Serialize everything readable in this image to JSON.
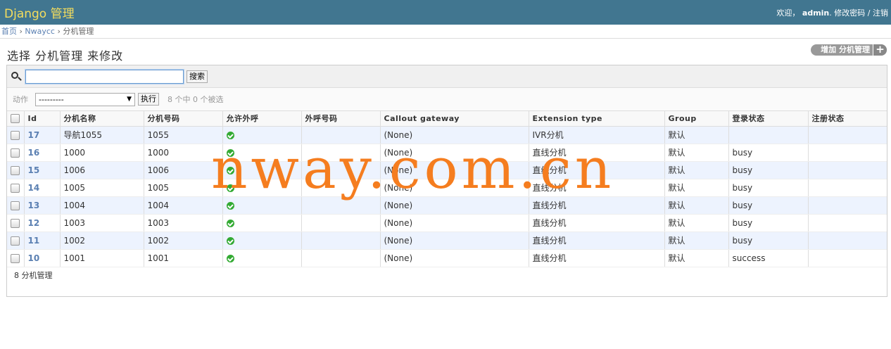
{
  "header": {
    "brand": "Django 管理",
    "welcome": "欢迎，",
    "username": "admin",
    "change_password": "修改密码",
    "separator": "/",
    "logout": "注销"
  },
  "breadcrumbs": {
    "home": "首页",
    "app": "Nwaycc",
    "current": "分机管理",
    "sep": "›"
  },
  "page": {
    "title": "选择 分机管理 来修改",
    "add_button": "增加 分机管理",
    "add_icon": "+"
  },
  "search": {
    "value": "",
    "button": "搜索"
  },
  "actions": {
    "label": "动作",
    "selected": "---------",
    "go": "执行",
    "counter": "8 个中 0 个被选"
  },
  "table": {
    "headers": [
      "Id",
      "分机名称",
      "分机号码",
      "允许外呼",
      "外呼号码",
      "Callout gateway",
      "Extension type",
      "Group",
      "登录状态",
      "注册状态"
    ],
    "rows": [
      {
        "id": "17",
        "name": "导航1055",
        "number": "1055",
        "allow": true,
        "out_number": "",
        "gateway": "(None)",
        "type": "IVR分机",
        "group": "默认",
        "login": "",
        "register": ""
      },
      {
        "id": "16",
        "name": "1000",
        "number": "1000",
        "allow": true,
        "out_number": "",
        "gateway": "(None)",
        "type": "直线分机",
        "group": "默认",
        "login": "busy",
        "register": ""
      },
      {
        "id": "15",
        "name": "1006",
        "number": "1006",
        "allow": true,
        "out_number": "",
        "gateway": "(None)",
        "type": "直线分机",
        "group": "默认",
        "login": "busy",
        "register": ""
      },
      {
        "id": "14",
        "name": "1005",
        "number": "1005",
        "allow": true,
        "out_number": "",
        "gateway": "(None)",
        "type": "直线分机",
        "group": "默认",
        "login": "busy",
        "register": ""
      },
      {
        "id": "13",
        "name": "1004",
        "number": "1004",
        "allow": true,
        "out_number": "",
        "gateway": "(None)",
        "type": "直线分机",
        "group": "默认",
        "login": "busy",
        "register": ""
      },
      {
        "id": "12",
        "name": "1003",
        "number": "1003",
        "allow": true,
        "out_number": "",
        "gateway": "(None)",
        "type": "直线分机",
        "group": "默认",
        "login": "busy",
        "register": ""
      },
      {
        "id": "11",
        "name": "1002",
        "number": "1002",
        "allow": true,
        "out_number": "",
        "gateway": "(None)",
        "type": "直线分机",
        "group": "默认",
        "login": "busy",
        "register": ""
      },
      {
        "id": "10",
        "name": "1001",
        "number": "1001",
        "allow": true,
        "out_number": "",
        "gateway": "(None)",
        "type": "直线分机",
        "group": "默认",
        "login": "success",
        "register": ""
      }
    ]
  },
  "paginator": "8 分机管理",
  "watermark": "nway.com.cn",
  "colors": {
    "header_bg": "#417690",
    "brand": "#f5dd5d",
    "link": "#5b80b2",
    "row_alt": "#edf3fe",
    "watermark": "#f57d1f",
    "yes_icon": "#33aa33"
  }
}
